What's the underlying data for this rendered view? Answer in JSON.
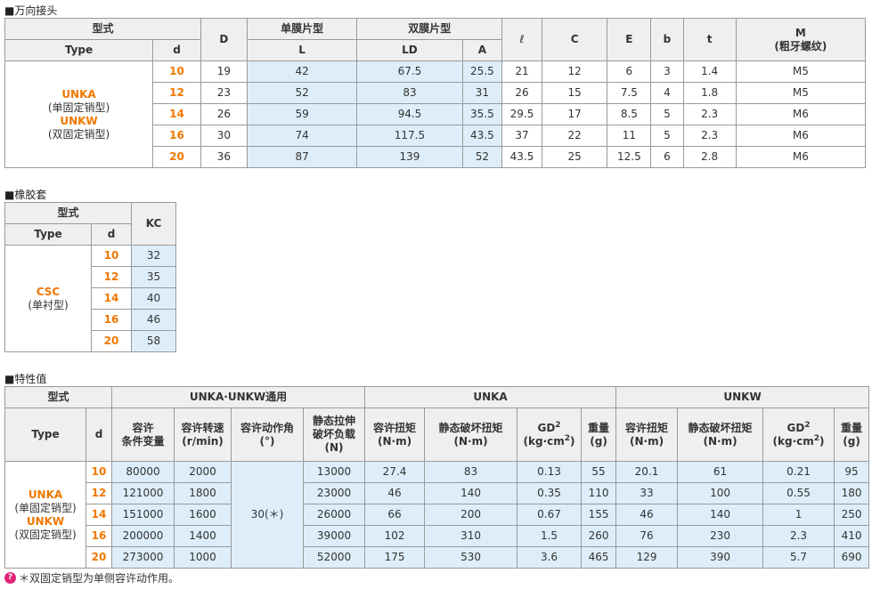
{
  "sections": {
    "joint": "■万向接头",
    "rubber": "■橡胶套",
    "props": "■特性值"
  },
  "t1": {
    "h_type_cn": "型式",
    "h_type_en": "Type",
    "h_d": "d",
    "h_D": "D",
    "h_single": "单膜片型",
    "h_L": "L",
    "h_double": "双膜片型",
    "h_LD": "LD",
    "h_A": "A",
    "h_l": "ℓ",
    "h_C": "C",
    "h_E": "E",
    "h_b": "b",
    "h_t": "t",
    "h_M": "M",
    "h_M_sub": "(粗牙螺纹)",
    "type_unka": "UNKA",
    "type_unka_sub": "(单固定销型)",
    "type_unkw": "UNKW",
    "type_unkw_sub": "(双固定销型)",
    "rows": [
      {
        "d": "10",
        "D": "19",
        "L": "42",
        "LD": "67.5",
        "A": "25.5",
        "l": "21",
        "C": "12",
        "E": "6",
        "b": "3",
        "t": "1.4",
        "M": "M5"
      },
      {
        "d": "12",
        "D": "23",
        "L": "52",
        "LD": "83",
        "A": "31",
        "l": "26",
        "C": "15",
        "E": "7.5",
        "b": "4",
        "t": "1.8",
        "M": "M5"
      },
      {
        "d": "14",
        "D": "26",
        "L": "59",
        "LD": "94.5",
        "A": "35.5",
        "l": "29.5",
        "C": "17",
        "E": "8.5",
        "b": "5",
        "t": "2.3",
        "M": "M6"
      },
      {
        "d": "16",
        "D": "30",
        "L": "74",
        "LD": "117.5",
        "A": "43.5",
        "l": "37",
        "C": "22",
        "E": "11",
        "b": "5",
        "t": "2.3",
        "M": "M6"
      },
      {
        "d": "20",
        "D": "36",
        "L": "87",
        "LD": "139",
        "A": "52",
        "l": "43.5",
        "C": "25",
        "E": "12.5",
        "b": "6",
        "t": "2.8",
        "M": "M6"
      }
    ]
  },
  "t2": {
    "h_type_cn": "型式",
    "h_type_en": "Type",
    "h_d": "d",
    "h_KC": "KC",
    "type_csc": "CSC",
    "type_csc_sub": "(单衬型)",
    "rows": [
      {
        "d": "10",
        "KC": "32"
      },
      {
        "d": "12",
        "KC": "35"
      },
      {
        "d": "14",
        "KC": "40"
      },
      {
        "d": "16",
        "KC": "46"
      },
      {
        "d": "20",
        "KC": "58"
      }
    ]
  },
  "t3": {
    "h_type_cn": "型式",
    "h_common": "UNKA·UNKW通用",
    "h_unka": "UNKA",
    "h_unkw": "UNKW",
    "h_type_en": "Type",
    "h_d": "d",
    "h_var1": "容许",
    "h_var2": "条件变量",
    "h_speed1": "容许转速",
    "h_speed2": "(r/min)",
    "h_angle1": "容许动作角",
    "h_angle2": "(°)",
    "h_tensile1": "静态拉伸",
    "h_tensile2": "破坏负载",
    "h_tensile3": "(N)",
    "h_torque1": "容许扭矩",
    "h_torque2": "(N·m)",
    "h_break1": "静态破坏扭矩",
    "h_break2": "(N·m)",
    "h_gd_main": "GD",
    "h_gd_sup": "2",
    "h_gd_unit": "(kg·cm",
    "h_gd_unit_sup": "2",
    "h_gd_close": ")",
    "h_weight1": "重量",
    "h_weight2": "(g)",
    "angle_value": "30(＊)",
    "type_unka": "UNKA",
    "type_unka_sub": "(单固定销型)",
    "type_unkw": "UNKW",
    "type_unkw_sub": "(双固定销型)",
    "rows": [
      {
        "d": "10",
        "var": "80000",
        "speed": "2000",
        "tensile": "13000",
        "a_torque": "27.4",
        "a_break": "83",
        "a_gd": "0.13",
        "a_w": "55",
        "w_torque": "20.1",
        "w_break": "61",
        "w_gd": "0.21",
        "w_w": "95"
      },
      {
        "d": "12",
        "var": "121000",
        "speed": "1800",
        "tensile": "23000",
        "a_torque": "46",
        "a_break": "140",
        "a_gd": "0.35",
        "a_w": "110",
        "w_torque": "33",
        "w_break": "100",
        "w_gd": "0.55",
        "w_w": "180"
      },
      {
        "d": "14",
        "var": "151000",
        "speed": "1600",
        "tensile": "26000",
        "a_torque": "66",
        "a_break": "200",
        "a_gd": "0.67",
        "a_w": "155",
        "w_torque": "46",
        "w_break": "140",
        "w_gd": "1",
        "w_w": "250"
      },
      {
        "d": "16",
        "var": "200000",
        "speed": "1400",
        "tensile": "39000",
        "a_torque": "102",
        "a_break": "310",
        "a_gd": "1.5",
        "a_w": "260",
        "w_torque": "76",
        "w_break": "230",
        "w_gd": "2.3",
        "w_w": "410"
      },
      {
        "d": "20",
        "var": "273000",
        "speed": "1000",
        "tensile": "52000",
        "a_torque": "175",
        "a_break": "530",
        "a_gd": "3.6",
        "a_w": "465",
        "w_torque": "129",
        "w_break": "390",
        "w_gd": "5.7",
        "w_w": "690"
      }
    ]
  },
  "note": {
    "icon": "info-icon",
    "icon_glyph": "?",
    "text": "＊双固定销型为单侧容许动作用。"
  }
}
